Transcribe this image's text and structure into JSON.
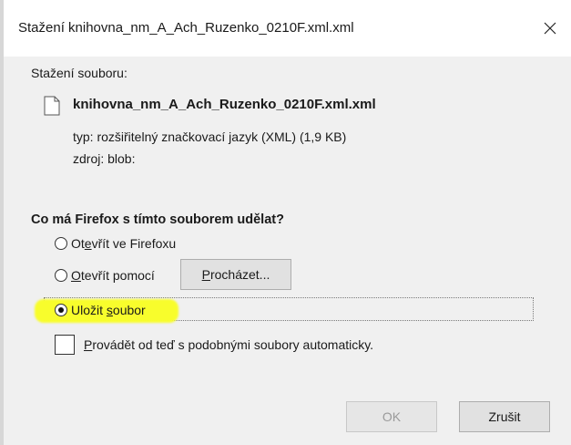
{
  "window": {
    "title": "Stažení knihovna_nm_A_Ach_Ruzenko_0210F.xml.xml",
    "close_icon": "close-icon"
  },
  "download": {
    "heading": "Stažení souboru:",
    "file_icon": "file-icon",
    "file_name": "knihovna_nm_A_Ach_Ruzenko_0210F.xml.xml",
    "type_line": "typ: rozšiřitelný značkovací jazyk (XML) (1,9 KB)",
    "source_line": "zdroj: blob:"
  },
  "action": {
    "question": "Co má Firefox s tímto souborem udělat?",
    "options": [
      {
        "label_pre": "Ot",
        "label_accel": "e",
        "label_post": "vřít ve Firefoxu",
        "checked": false
      },
      {
        "label_pre": "",
        "label_accel": "O",
        "label_post": "tevřít pomocí",
        "checked": false
      },
      {
        "label_pre": "Uložit ",
        "label_accel": "s",
        "label_post": "oubor",
        "checked": true
      }
    ],
    "browse_button": {
      "label_accel": "P",
      "label_post": "rocházet..."
    },
    "auto_checkbox": {
      "label_accel": "P",
      "label_post": "rovádět od teď s podobnými soubory automaticky.",
      "checked": false
    }
  },
  "buttons": {
    "ok": "OK",
    "cancel": "Zrušit",
    "ok_enabled": false
  },
  "colors": {
    "highlight": "#f8fd2c",
    "dialog_bg": "#f0f0f0",
    "button_bg": "#e1e1e1"
  }
}
